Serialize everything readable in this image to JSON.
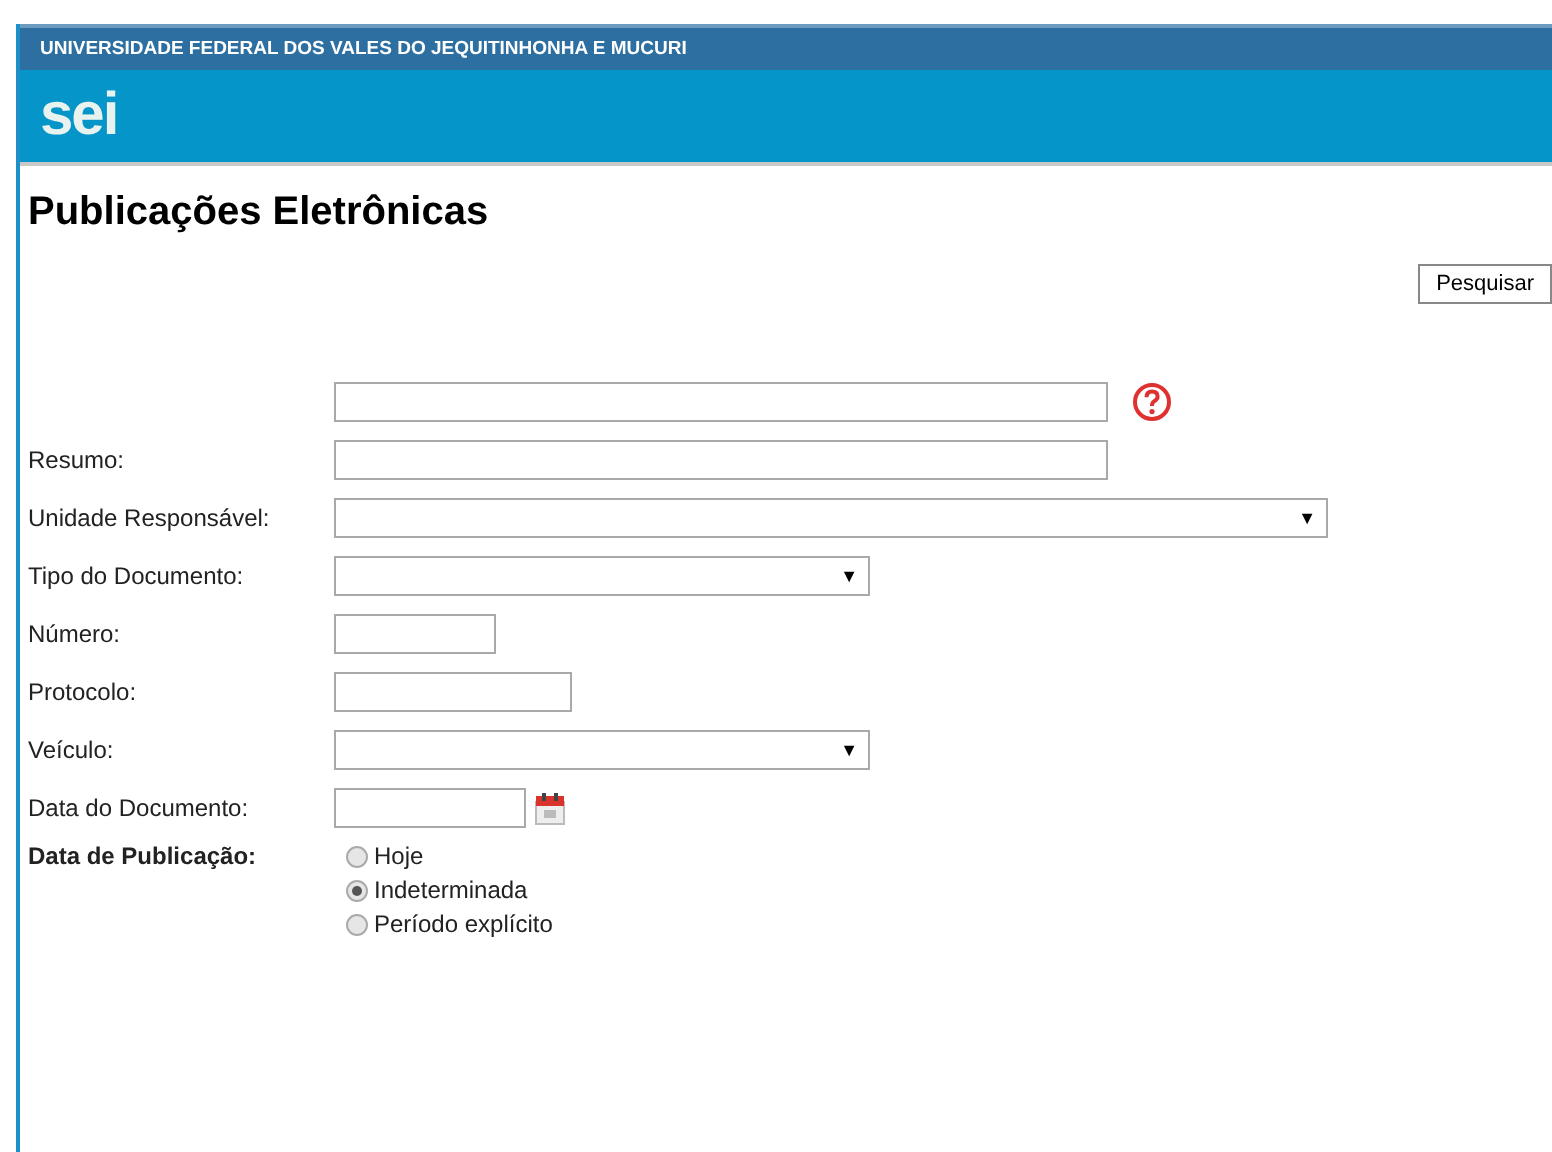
{
  "header": {
    "institution": "UNIVERSIDADE FEDERAL DOS VALES DO JEQUITINHONHA E MUCURI",
    "logo": "sei"
  },
  "page_title": "Publicações Eletrônicas",
  "search_button": "Pesquisar",
  "fields": [
    {
      "kind": "text",
      "help": true
    },
    {
      "kind": "text",
      "label": "Resumo:"
    },
    {
      "kind": "select",
      "label": "Unidade Responsável:",
      "dropdown_arrow": "▼"
    },
    {
      "kind": "select",
      "label": "Tipo do Documento:",
      "dropdown_arrow": "▼"
    },
    {
      "kind": "text",
      "label": "Número:"
    },
    {
      "kind": "text",
      "label": "Protocolo:"
    },
    {
      "kind": "select",
      "label": "Veículo:",
      "dropdown_arrow": "▼"
    },
    {
      "kind": "date",
      "label": "Data do Documento:"
    }
  ],
  "publication_date": {
    "label": "Data de Publicação:",
    "options": [
      {
        "label": "Hoje",
        "selected": false
      },
      {
        "label": "Indeterminada",
        "selected": true
      },
      {
        "label": "Período explícito",
        "selected": false
      }
    ]
  }
}
